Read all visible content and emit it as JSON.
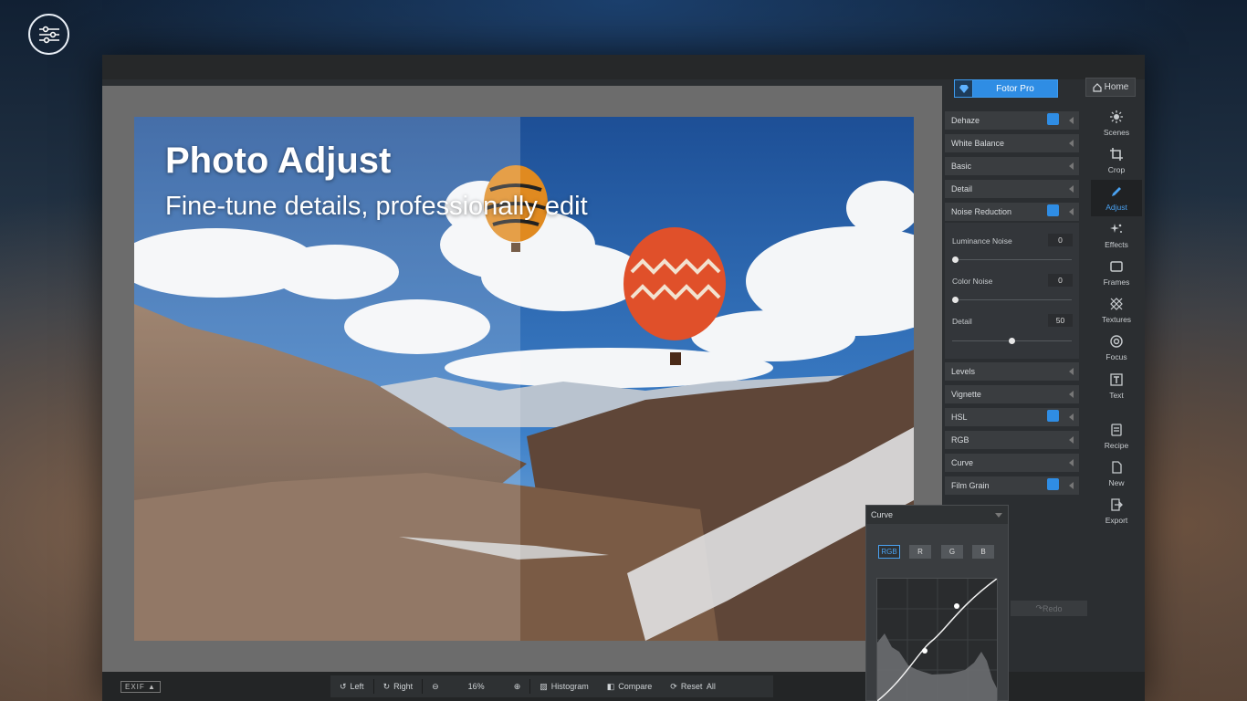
{
  "header": {
    "menu_icon": "sliders-icon"
  },
  "photo": {
    "title": "Photo Adjust",
    "subtitle": "Fine-tune details, professionally edit"
  },
  "panel": {
    "fotor_pro": "Fotor Pro",
    "home": "Home",
    "rows_top": [
      {
        "label": "Dehaze",
        "pro": true
      },
      {
        "label": "White Balance",
        "pro": false
      },
      {
        "label": "Basic",
        "pro": false
      },
      {
        "label": "Detail",
        "pro": false
      },
      {
        "label": "Noise Reduction",
        "pro": true
      }
    ],
    "noise": {
      "luminance_label": "Luminance Noise",
      "luminance_value": "0",
      "luminance_level": 0,
      "color_label": "Color Noise",
      "color_value": "0",
      "color_level": 0,
      "detail_label": "Detail",
      "detail_value": "50",
      "detail_level": 50
    },
    "rows_bottom": [
      {
        "label": "Levels",
        "pro": false
      },
      {
        "label": "Vignette",
        "pro": false
      },
      {
        "label": "HSL",
        "pro": true
      },
      {
        "label": "RGB",
        "pro": false
      },
      {
        "label": "Curve",
        "pro": false
      },
      {
        "label": "Film Grain",
        "pro": true
      }
    ],
    "redo": "Redo"
  },
  "sidebar": {
    "items": [
      {
        "label": "Scenes",
        "icon": "sun-icon"
      },
      {
        "label": "Crop",
        "icon": "crop-icon"
      },
      {
        "label": "Adjust",
        "icon": "pencil-icon",
        "active": true
      },
      {
        "label": "Effects",
        "icon": "sparkles-icon"
      },
      {
        "label": "Frames",
        "icon": "frame-icon"
      },
      {
        "label": "Textures",
        "icon": "texture-icon"
      },
      {
        "label": "Focus",
        "icon": "focus-icon"
      },
      {
        "label": "Text",
        "icon": "text-icon"
      },
      {
        "label": "Recipe",
        "icon": "recipe-icon"
      },
      {
        "label": "New",
        "icon": "new-file-icon"
      },
      {
        "label": "Export",
        "icon": "export-icon"
      }
    ]
  },
  "bottom": {
    "exif": "EXIF",
    "left": "Left",
    "right": "Right",
    "zoom": "16%",
    "histogram": "Histogram",
    "compare": "Compare",
    "reset_all": "Reset  All"
  },
  "curve": {
    "title": "Curve",
    "channels": [
      "RGB",
      "R",
      "G",
      "B"
    ],
    "active_channel": "RGB"
  },
  "colors": {
    "accent": "#2f8de4",
    "panel": "#2b2e31",
    "row": "#3a3d40"
  }
}
